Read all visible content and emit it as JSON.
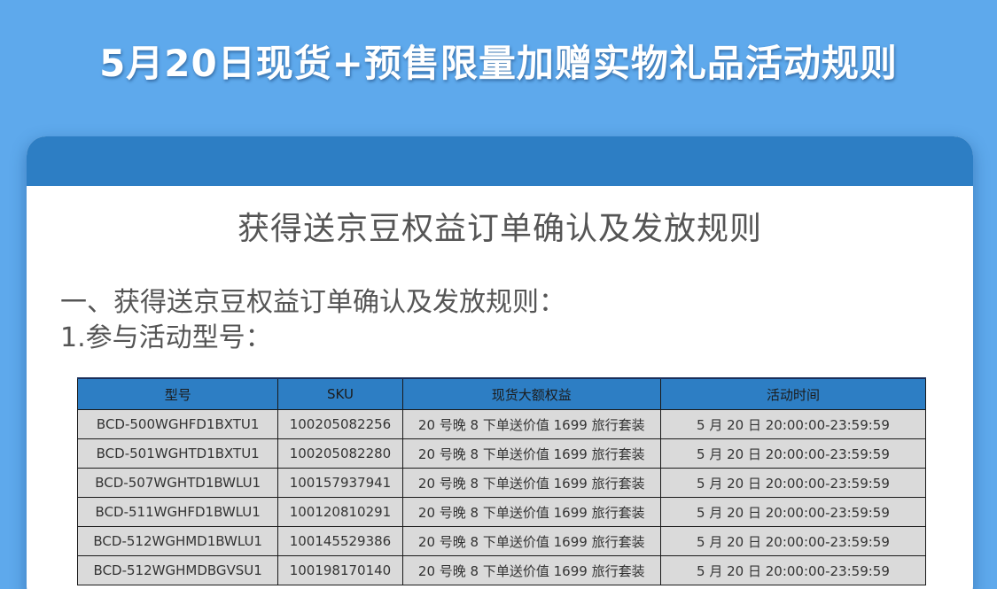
{
  "banner": {
    "title": "5月20日现货+预售限量加赠实物礼品活动规则"
  },
  "card": {
    "title": "获得送京豆权益订单确认及发放规则",
    "section_heading": "一、获得送京豆权益订单确认及发放规则：",
    "subsection_heading": "1.参与活动型号："
  },
  "table": {
    "headers": [
      "型号",
      "SKU",
      "现货大额权益",
      "活动时间"
    ],
    "rows": [
      [
        "BCD-500WGHFD1BXTU1",
        "100205082256",
        "20 号晚 8  下单送价值 1699 旅行套装",
        "5 月 20 日  20:00:00-23:59:59"
      ],
      [
        "BCD-501WGHTD1BXTU1",
        "100205082280",
        "20 号晚 8  下单送价值 1699 旅行套装",
        "5 月 20 日  20:00:00-23:59:59"
      ],
      [
        "BCD-507WGHTD1BWLU1",
        "100157937941",
        "20 号晚 8  下单送价值 1699 旅行套装",
        "5 月 20 日  20:00:00-23:59:59"
      ],
      [
        "BCD-511WGHFD1BWLU1",
        "100120810291",
        "20 号晚 8  下单送价值 1699 旅行套装",
        "5 月 20 日  20:00:00-23:59:59"
      ],
      [
        "BCD-512WGHMD1BWLU1",
        "100145529386",
        "20 号晚 8  下单送价值 1699 旅行套装",
        "5 月 20 日  20:00:00-23:59:59"
      ],
      [
        "BCD-512WGHMDBGVSU1",
        "100198170140",
        "20 号晚 8  下单送价值 1699 旅行套装",
        "5 月 20 日  20:00:00-23:59:59"
      ]
    ]
  },
  "colors": {
    "background": "#5ea9ec",
    "accent": "#2d7ec4",
    "cell": "#dadada"
  }
}
